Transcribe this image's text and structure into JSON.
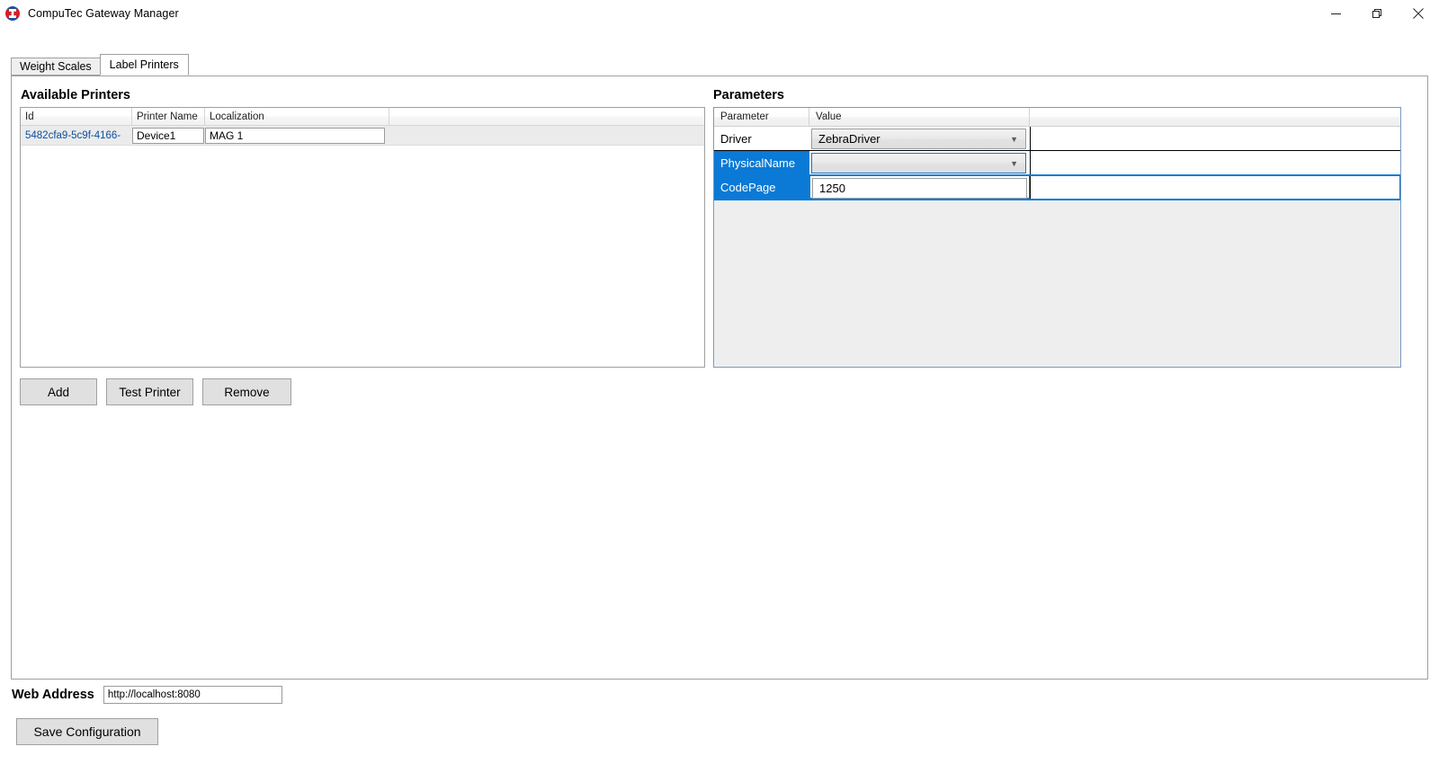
{
  "window": {
    "title": "CompuTec Gateway Manager",
    "icon": "app-logo-icon",
    "controls": {
      "minimize": "minimize-icon",
      "restore": "restore-icon",
      "close": "close-icon"
    }
  },
  "tabs": [
    {
      "label": "Weight Scales",
      "active": false
    },
    {
      "label": "Label Printers",
      "active": true
    }
  ],
  "printers": {
    "caption": "Available Printers",
    "columns": [
      "Id",
      "Printer Name",
      "Localization",
      ""
    ],
    "rows": [
      {
        "id": "5482cfa9-5c9f-4166-",
        "printer_name": "Device1",
        "localization": "MAG 1"
      }
    ],
    "buttons": {
      "add": "Add",
      "test": "Test Printer",
      "remove": "Remove"
    }
  },
  "parameters": {
    "caption": "Parameters",
    "columns": [
      "Parameter",
      "Value",
      ""
    ],
    "rows": [
      {
        "name": "Driver",
        "value": "ZebraDriver",
        "kind": "combo",
        "selected": false,
        "editing": false
      },
      {
        "name": "PhysicalName",
        "value": "",
        "kind": "combo",
        "selected": true,
        "editing": false
      },
      {
        "name": "CodePage",
        "value": "1250",
        "kind": "text",
        "selected": true,
        "editing": true
      }
    ]
  },
  "footer": {
    "web_address_label": "Web Address",
    "web_address_value": "http://localhost:8080",
    "web_address_placeholder": "http://localhost:8080",
    "save_label": "Save Configuration"
  },
  "colors": {
    "selection_blue": "#0a7ad6",
    "link_blue": "#0b4f9e",
    "button_face": "#e0e0e0",
    "panel_border": "#a0a0a0",
    "params_border": "#7a9ac0"
  }
}
